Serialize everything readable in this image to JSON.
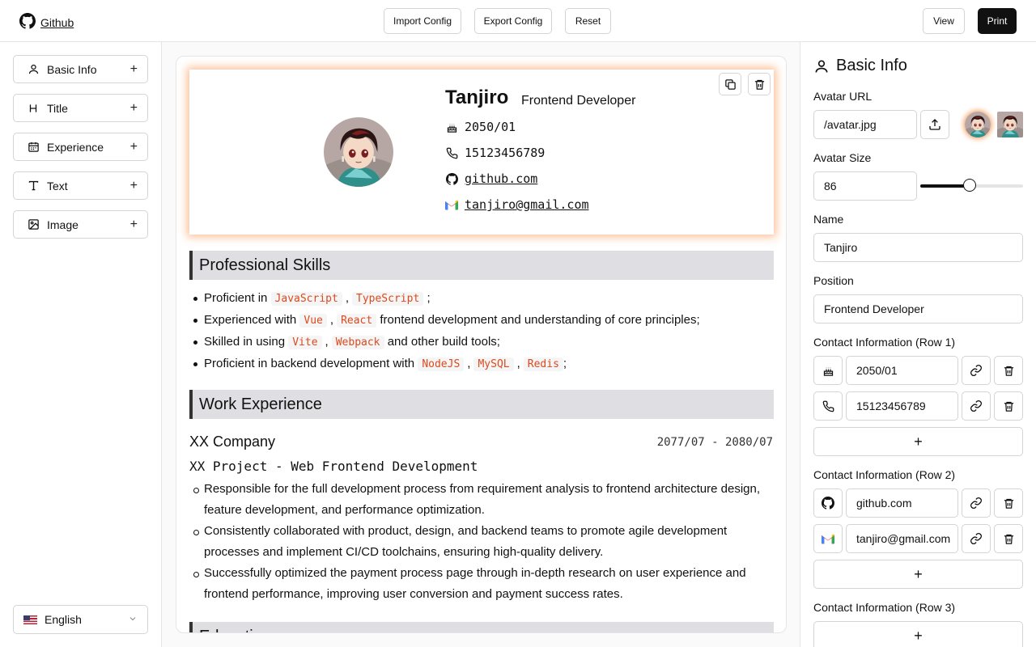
{
  "header": {
    "brand": "Github",
    "import_label": "Import Config",
    "export_label": "Export Config",
    "reset_label": "Reset",
    "view_label": "View",
    "print_label": "Print"
  },
  "sidebar": {
    "modules": [
      {
        "label": "Basic Info",
        "icon": "user-icon"
      },
      {
        "label": "Title",
        "icon": "heading-icon"
      },
      {
        "label": "Experience",
        "icon": "calendar-icon"
      },
      {
        "label": "Text",
        "icon": "text-icon"
      },
      {
        "label": "Image",
        "icon": "image-icon"
      }
    ],
    "add_glyph": "+",
    "language": "English"
  },
  "resume": {
    "name": "Tanjiro",
    "position": "Frontend Developer",
    "birth": "2050/01",
    "phone": "15123456789",
    "github": "github.com",
    "email": "tanjiro@gmail.com",
    "skills_title": "Professional Skills",
    "skills": {
      "s1_pre": "Proficient in",
      "s1_c1": "JavaScript",
      "s1_c2": "TypeScript",
      "s1_post": ";",
      "s2_pre": "Experienced with",
      "s2_c1": "Vue",
      "s2_c2": "React",
      "s2_post": "frontend development and understanding of core principles;",
      "s3_pre": "Skilled in using",
      "s3_c1": "Vite",
      "s3_c2": "Webpack",
      "s3_post": "and other build tools;",
      "s4_pre": "Proficient in backend development with",
      "s4_c1": "NodeJS",
      "s4_c2": "MySQL",
      "s4_c3": "Redis",
      "s4_post": ";"
    },
    "comma": ",",
    "work_title": "Work Experience",
    "company": "XX Company",
    "period": "2077/07 - 2080/07",
    "project": "XX Project - Web Frontend Development",
    "duties": [
      "Responsible for the full development process from requirement analysis to frontend architecture design, feature development, and performance optimization.",
      "Consistently collaborated with product, design, and backend teams to promote agile development processes and implement CI/CD toolchains, ensuring high-quality delivery.",
      "Successfully optimized the payment process page through in-depth research on user experience and frontend performance, improving user conversion and payment success rates."
    ],
    "education_title": "Education"
  },
  "panel": {
    "title": "Basic Info",
    "avatar_url_label": "Avatar URL",
    "avatar_url": "/avatar.jpg",
    "avatar_size_label": "Avatar Size",
    "avatar_size": "86",
    "avatar_size_fraction": 0.48,
    "name_label": "Name",
    "name": "Tanjiro",
    "position_label": "Position",
    "position": "Frontend Developer",
    "row1_label": "Contact Information (Row 1)",
    "row1": [
      "2050/01",
      "15123456789"
    ],
    "row2_label": "Contact Information (Row 2)",
    "row2": [
      "github.com",
      "tanjiro@gmail.com"
    ],
    "row3_label": "Contact Information (Row 3)",
    "add_glyph": "+"
  },
  "colors": {
    "accent": "#111111",
    "code_text": "#dc4a1e",
    "profile_glow": "#f97316",
    "section_bg": "#dfdfe3"
  }
}
